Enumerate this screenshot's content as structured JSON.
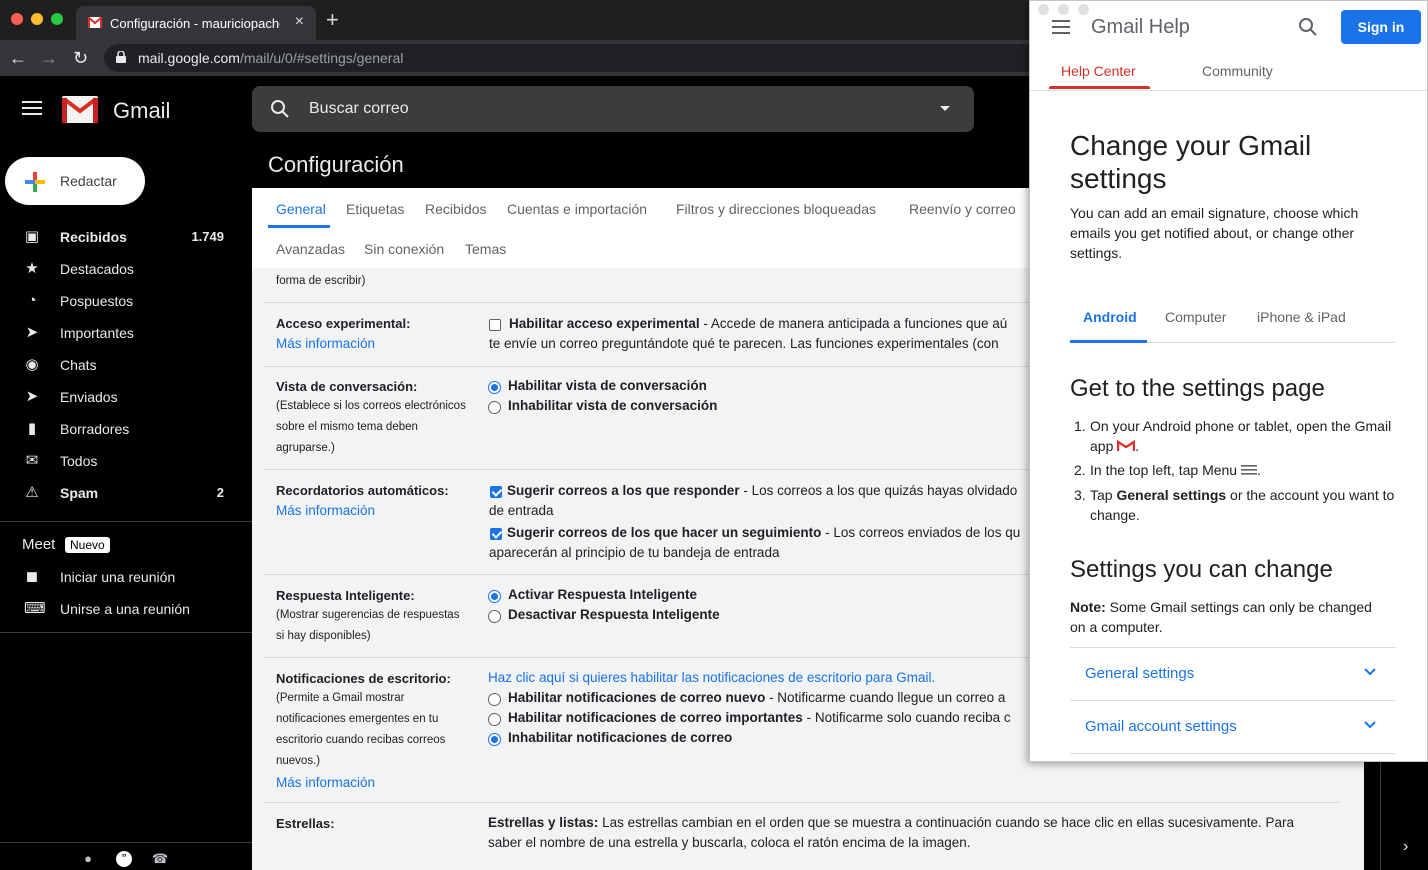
{
  "browser": {
    "tab_title": "Configuración - mauriciopache",
    "new_tab": "+",
    "close": "×",
    "url_host": "mail.google.com",
    "url_path": "/mail/u/0/#settings/general"
  },
  "gmail": {
    "product": "Gmail",
    "search_placeholder": "Buscar correo"
  },
  "sidebar": {
    "compose": "Redactar",
    "items": [
      {
        "label": "Recibidos",
        "count": "1.749",
        "icon": "inbox-icon"
      },
      {
        "label": "Destacados",
        "count": "",
        "icon": "star-icon"
      },
      {
        "label": "Pospuestos",
        "count": "",
        "icon": "clock-icon"
      },
      {
        "label": "Importantes",
        "count": "",
        "icon": "important-icon"
      },
      {
        "label": "Chats",
        "count": "",
        "icon": "chat-icon"
      },
      {
        "label": "Enviados",
        "count": "",
        "icon": "send-icon"
      },
      {
        "label": "Borradores",
        "count": "",
        "icon": "draft-icon"
      },
      {
        "label": "Todos",
        "count": "",
        "icon": "mail-icon"
      },
      {
        "label": "Spam",
        "count": "2",
        "icon": "spam-icon"
      }
    ],
    "meet_title": "Meet",
    "meet_badge": "Nuevo",
    "meet_items": [
      "Iniciar una reunión",
      "Unirse a una reunión"
    ]
  },
  "settings": {
    "title": "Configuración",
    "tabs_row1": [
      "General",
      "Etiquetas",
      "Recibidos",
      "Cuentas e importación",
      "Filtros y direcciones bloqueadas",
      "Reenvío y correo"
    ],
    "tabs_row2": [
      "Avanzadas",
      "Sin conexión",
      "Temas"
    ],
    "top_fragment": "forma de escribir)",
    "more_info": "Más información",
    "experimental": {
      "label": "Acceso experimental:",
      "option_bold": "Habilitar acceso experimental",
      "option_rest": " - Accede de manera anticipada a funciones que aú",
      "line2": "te envíe un correo preguntándote qué te parecen. Las funciones experimentales (con"
    },
    "conversation": {
      "label": "Vista de conversación:",
      "desc1": "(Establece si los correos electrónicos",
      "desc2": "sobre el mismo tema deben",
      "desc3": "agruparse.)",
      "opt_on": "Habilitar vista de conversación",
      "opt_off": "Inhabilitar vista de conversación"
    },
    "nudges": {
      "label": "Recordatorios automáticos:",
      "opt1_bold": "Sugerir correos a los que responder",
      "opt1_rest": " - Los correos a los que quizás hayas olvidado",
      "opt1_line2": "de entrada",
      "opt2_bold": "Sugerir correos de los que hacer un seguimiento",
      "opt2_rest": " - Los correos enviados de los qu",
      "opt2_line2": "aparecerán al principio de tu bandeja de entrada"
    },
    "smart_reply": {
      "label": "Respuesta Inteligente:",
      "desc1": "(Mostrar sugerencias de respuestas",
      "desc2": "si hay disponibles)",
      "opt_on": "Activar Respuesta Inteligente",
      "opt_off": "Desactivar Respuesta Inteligente"
    },
    "desktop_notif": {
      "label": "Notificaciones de escritorio:",
      "desc1": "(Permite a Gmail mostrar",
      "desc2": "notificaciones emergentes en tu",
      "desc3": "escritorio cuando recibas correos",
      "desc4": "nuevos.)",
      "enable_link": "Haz clic aquí si quieres habilitar las notificaciones de escritorio para Gmail.",
      "opt1_bold": "Habilitar notificaciones de correo nuevo",
      "opt1_rest": " - Notificarme cuando llegue un correo a",
      "opt2_bold": "Habilitar notificaciones de correo importantes",
      "opt2_rest": " - Notificarme solo cuando reciba c",
      "opt3_bold": "Inhabilitar notificaciones de correo"
    },
    "stars": {
      "label": "Estrellas:",
      "bold": "Estrellas y listas:",
      "rest": " Las estrellas cambian en el orden que se muestra a continuación cuando se hace clic en ellas sucesivamente. Para",
      "line2": "saber el nombre de una estrella y buscarla, coloca el ratón encima de la imagen."
    }
  },
  "help": {
    "title": "Gmail Help",
    "sign_in": "Sign in",
    "tabs": [
      "Help Center",
      "Community"
    ],
    "heading": "Change your Gmail settings",
    "intro": "You can add an email signature, choose which emails you get notified about, or change other settings.",
    "platform_tabs": [
      "Android",
      "Computer",
      "iPhone & iPad"
    ],
    "section1": "Get to the settings page",
    "steps": [
      {
        "num": "1.",
        "text_a": "On your Android phone or tablet, open the Gmail",
        "text_b": "app ",
        "text_c": "."
      },
      {
        "num": "2.",
        "text_a": "In the top left, tap Menu ",
        "text_c": "."
      },
      {
        "num": "3.",
        "text_pre": "Tap ",
        "text_bold": "General settings",
        "text_post": " or the account you want to change."
      }
    ],
    "section2": "Settings you can change",
    "note_bold": "Note:",
    "note_rest": " Some Gmail settings can only be changed on a computer.",
    "accordions": [
      "General settings",
      "Gmail account settings"
    ]
  },
  "colors": {
    "accent": "#1a73e8",
    "help_red": "#d93025",
    "dark_bg": "#000000"
  }
}
